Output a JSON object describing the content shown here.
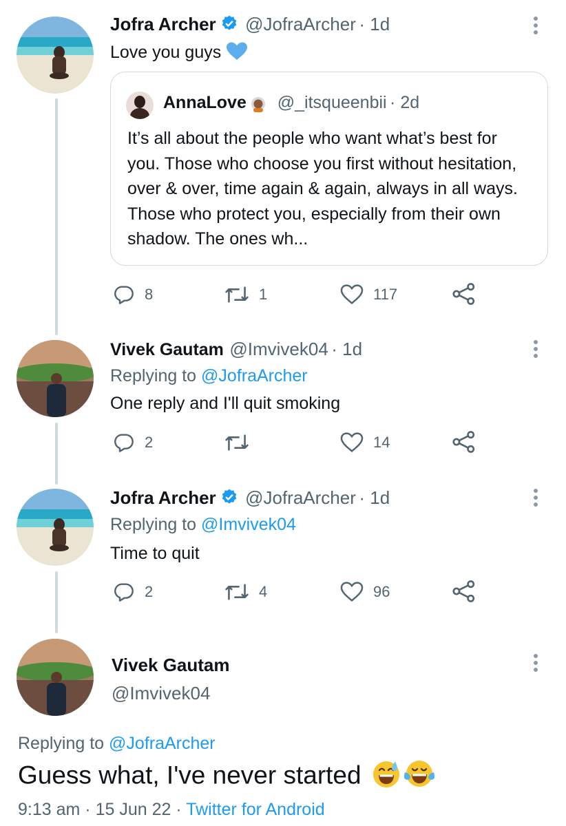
{
  "tweets": [
    {
      "name": "Jofra Archer",
      "handle": "@JofraArcher",
      "time": "1d",
      "text": "Love you guys",
      "emoji": "blue-heart",
      "quote": {
        "name": "AnnaLove",
        "handle": "@_itsqueenbii",
        "time": "2d",
        "text": "It’s all about the people who want what’s best for you. Those who choose you first without hesitation, over & over, time again & again, always in all ways. Those who protect you, especially from their own shadow. The ones wh..."
      },
      "replies": "8",
      "retweets": "1",
      "likes": "117"
    },
    {
      "name": "Vivek Gautam",
      "handle": "@Imvivek04",
      "time": "1d",
      "replying_label": "Replying to",
      "replying_to": "@JofraArcher",
      "text": "One reply and I'll quit smoking",
      "replies": "2",
      "retweets": "",
      "likes": "14"
    },
    {
      "name": "Jofra Archer",
      "handle": "@JofraArcher",
      "time": "1d",
      "replying_label": "Replying to",
      "replying_to": "@Imvivek04",
      "text": "Time to quit",
      "replies": "2",
      "retweets": "4",
      "likes": "96"
    }
  ],
  "main": {
    "name": "Vivek Gautam",
    "handle": "@Imvivek04",
    "replying_label": "Replying to",
    "replying_to": "@JofraArcher",
    "text": "Guess what, I've never started",
    "emojis": [
      "sweat-smile",
      "tears-of-joy"
    ],
    "time": "9:13 am",
    "date": "15 Jun 22",
    "source": "Twitter for Android"
  },
  "colors": {
    "link": "#1d9bf0",
    "secondary": "#536471",
    "verified": "#1d9bf0"
  }
}
